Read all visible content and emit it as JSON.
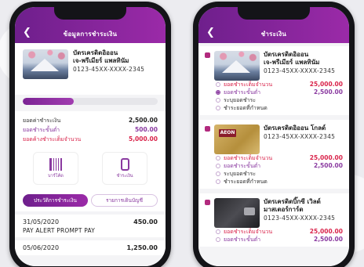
{
  "left": {
    "header": {
      "back_icon": "chevron-left-icon",
      "title": "ข้อมูลการชำระเงิน"
    },
    "card": {
      "name_line1": "บัตรเครดิตอิออน",
      "name_line2": "เจ-พรีเมียร์ แพลทินัม",
      "number": "0123-45XX-XXXX-2345"
    },
    "progress": {
      "fraction": 0.38
    },
    "amounts": [
      {
        "label": "ยอดค่าชำระเงิน",
        "value": "2,500.00",
        "style": "plain"
      },
      {
        "label": "ยอดชำระขั้นต่ำ",
        "value": "500.00",
        "style": "purple"
      },
      {
        "label": "ยอดค้างชำระเต็มจำนวน",
        "value": "5,000.00",
        "style": "red"
      }
    ],
    "actions": [
      {
        "label": "บาร์โค้ด",
        "icon": "barcode-icon"
      },
      {
        "label": "ชำระเงิน",
        "icon": "mobile-pay-icon"
      }
    ],
    "tabs": [
      {
        "label": "ประวัติการชำระเงิน",
        "active": true
      },
      {
        "label": "รายการเดินบัญชี",
        "active": false
      }
    ],
    "transactions": [
      {
        "date": "31/05/2020",
        "amount": "450.00",
        "description": "PAY ALERT PROMPT PAY"
      },
      {
        "date": "05/06/2020",
        "amount": "1,250.00",
        "description": ""
      }
    ]
  },
  "right": {
    "header": {
      "back_icon": "chevron-left-icon",
      "title": "ชำระเงิน"
    },
    "cards": [
      {
        "name_line1": "บัตรเครดิตอิออน",
        "name_line2": "เจ-พรีเมียร์ แพลทินัม",
        "number": "0123-45XX-XXXX-2345",
        "image": "fuji",
        "options": [
          {
            "label": "ยอดชำระเต็มจำนวน",
            "value": "25,000.00",
            "style": "red",
            "selected": false
          },
          {
            "label": "ยอดชำระขั้นต่ำ",
            "value": "2,500.00",
            "style": "purple",
            "selected": true
          },
          {
            "label": "ระบุยอดชำระ",
            "value": "",
            "style": "plain",
            "selected": false
          },
          {
            "label": "ชำระยอดที่กำหนด",
            "value": "",
            "style": "plain",
            "selected": false
          }
        ]
      },
      {
        "name_line1": "บัตรเครดิตอิออน โกลด์",
        "name_line2": "",
        "number": "0123-45XX-XXXX-2345",
        "image": "gold",
        "brand_text": "AEON",
        "options": [
          {
            "label": "ยอดชำระเต็มจำนวน",
            "value": "25,000.00",
            "style": "red",
            "selected": false
          },
          {
            "label": "ยอดชำระขั้นต่ำ",
            "value": "2,500.00",
            "style": "purple",
            "selected": false
          },
          {
            "label": "ระบุยอดชำระ",
            "value": "",
            "style": "plain",
            "selected": false
          },
          {
            "label": "ชำระยอดที่กำหนด",
            "value": "",
            "style": "plain",
            "selected": false
          }
        ]
      },
      {
        "name_line1": "บัตรเครดิตบิ๊กซี เวิลด์",
        "name_line2": "มาสเตอร์การ์ด",
        "number": "0123-45XX-XXXX-2345",
        "image": "black",
        "options": [
          {
            "label": "ยอดชำระเต็มจำนวน",
            "value": "25,000.00",
            "style": "red",
            "selected": false
          },
          {
            "label": "ยอดชำระขั้นต่ำ",
            "value": "2,500.00",
            "style": "purple",
            "selected": false
          }
        ]
      }
    ]
  },
  "colors": {
    "brand_purple": "#8a3aa0",
    "header_gradient_start": "#6e1f8c",
    "header_gradient_end": "#9b2aa8",
    "alert_red": "#d9234a"
  }
}
